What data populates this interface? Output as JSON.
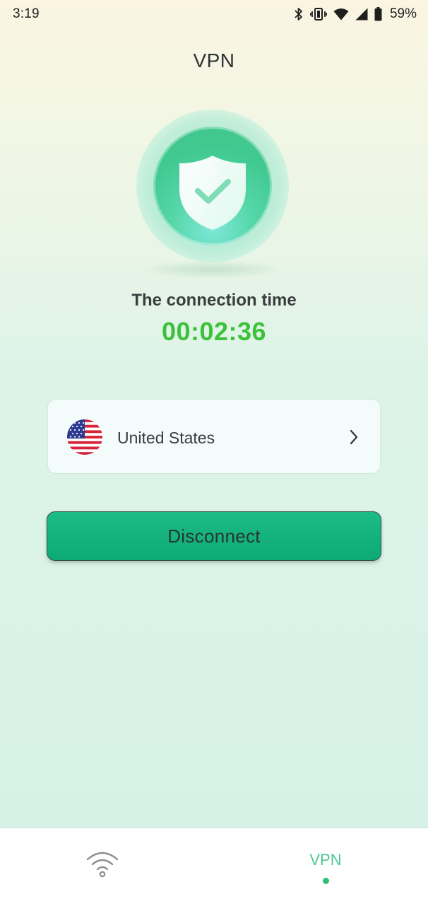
{
  "status_bar": {
    "time": "3:19",
    "battery_percent": "59%",
    "icons": [
      "bluetooth-icon",
      "vibrate-icon",
      "wifi-icon",
      "cellular-signal-icon",
      "battery-icon"
    ]
  },
  "header": {
    "title": "VPN"
  },
  "status_card": {
    "shield_icon": "shield-check-icon",
    "connection_label": "The connection time",
    "connection_time": "00:02:36"
  },
  "server": {
    "flag": "us-flag-icon",
    "name": "United States",
    "chevron": "chevron-right-icon"
  },
  "actions": {
    "disconnect_label": "Disconnect"
  },
  "bottom_nav": {
    "items": [
      {
        "icon": "wifi-icon",
        "label": "",
        "active": false
      },
      {
        "icon": "",
        "label": "VPN",
        "active": true
      }
    ]
  },
  "colors": {
    "accent_green": "#3cc23a",
    "button_green": "#0daa74",
    "nav_active": "#4ec795"
  }
}
